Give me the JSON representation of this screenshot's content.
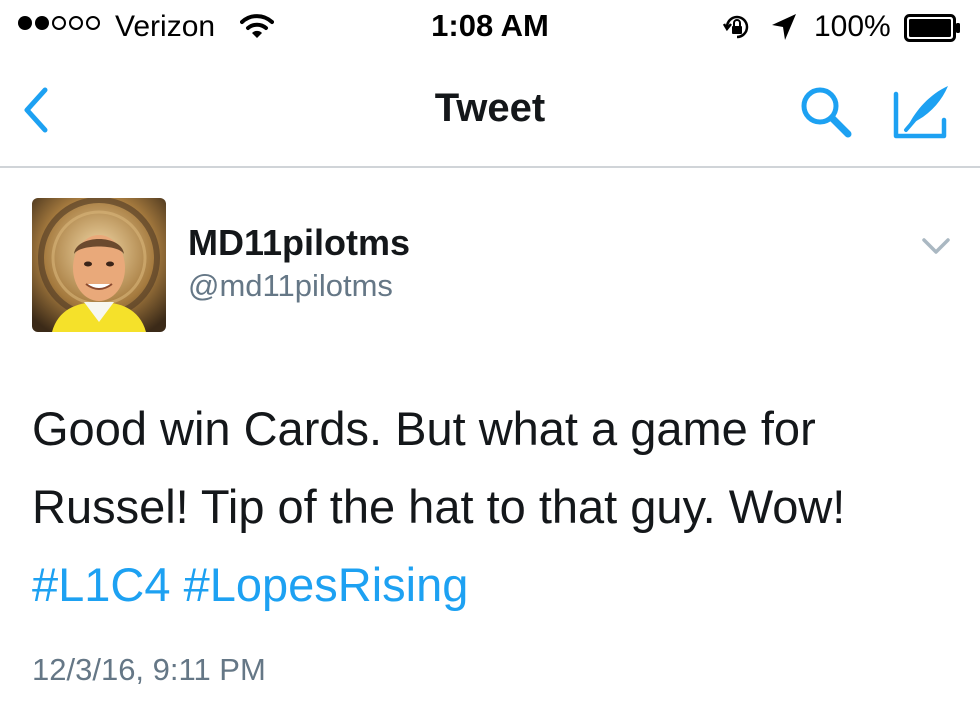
{
  "status_bar": {
    "carrier": "Verizon",
    "time": "1:08 AM",
    "battery_percent": "100%",
    "signal_bars_filled": 2,
    "signal_bars_total": 5,
    "battery_level": 1.0,
    "icons": [
      "wifi-icon",
      "rotation-lock-icon",
      "location-arrow-icon",
      "battery-icon"
    ]
  },
  "nav": {
    "title": "Tweet",
    "back_icon": "chevron-left-icon",
    "search_icon": "search-icon",
    "compose_icon": "compose-tweet-icon",
    "accent_color": "#1da1f2"
  },
  "tweet": {
    "author": {
      "display_name": "MD11pilotms",
      "handle": "@md11pilotms"
    },
    "text_lines": [
      "Good win Cards. But what a game for",
      "Russel!  Tip of the hat to that guy. Wow!"
    ],
    "hashtags": [
      "#L1C4",
      "#LopesRising"
    ],
    "timestamp": "12/3/16, 9:11 PM",
    "hashtag_color": "#1da1f2",
    "muted_text_color": "#657786"
  }
}
